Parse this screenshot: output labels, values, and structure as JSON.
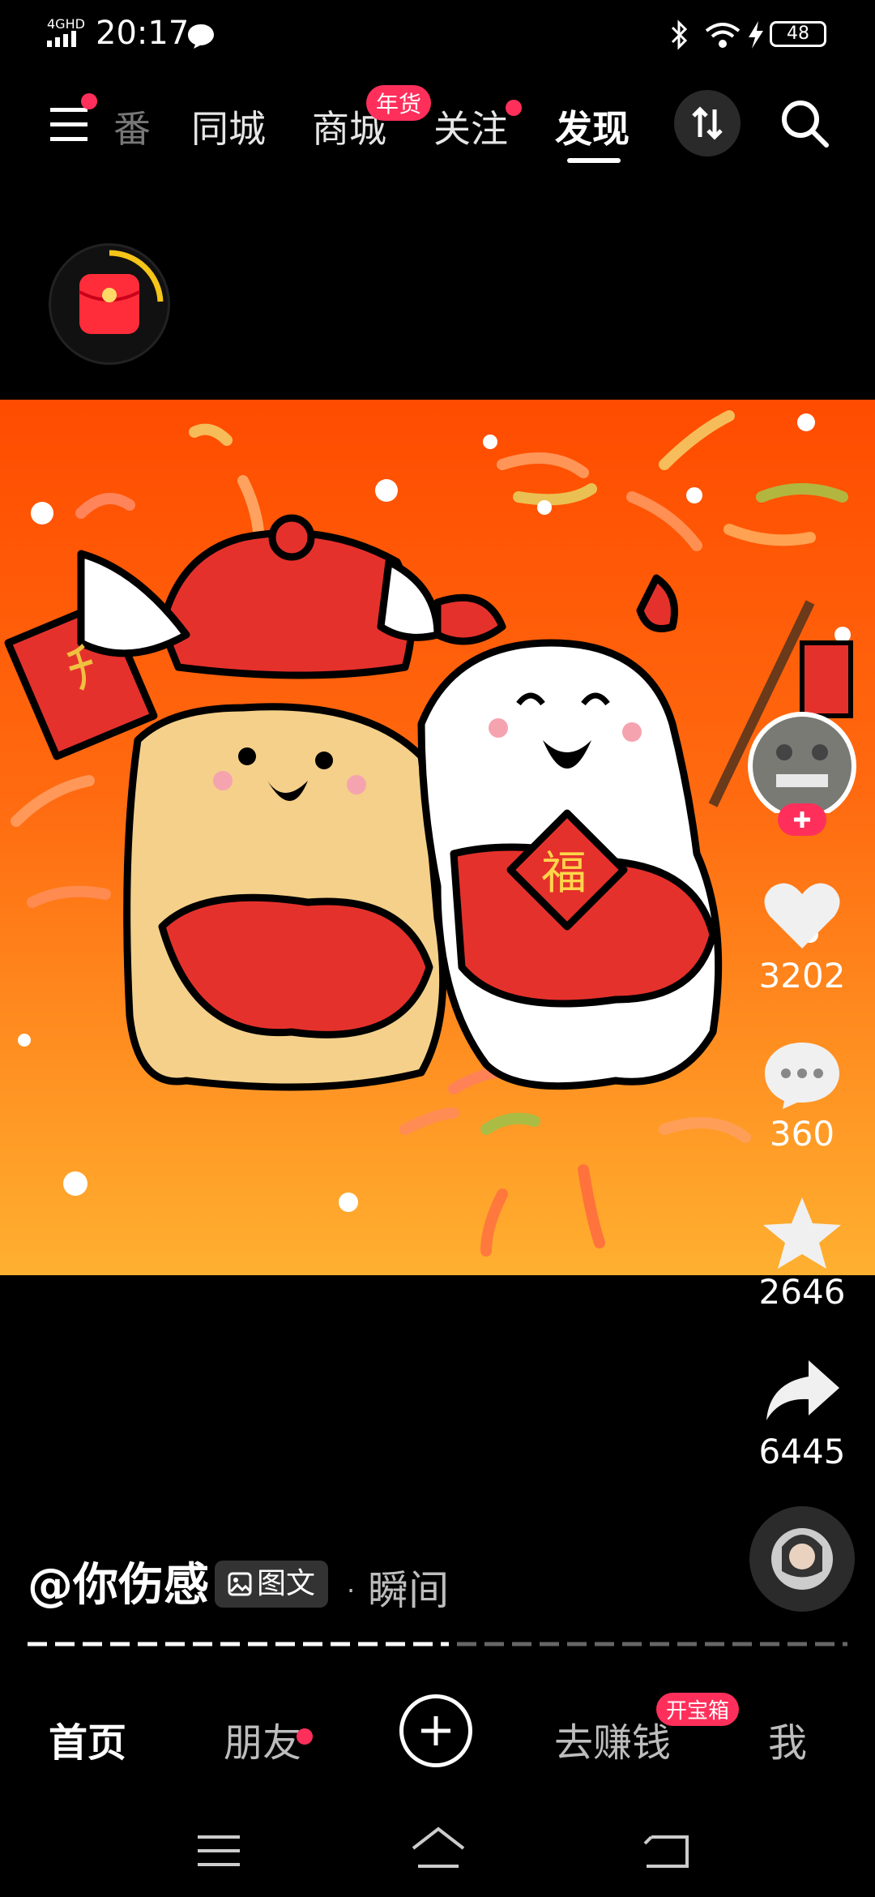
{
  "status_bar": {
    "network": "4GHD",
    "time": "20:17",
    "battery": "48"
  },
  "top_nav": {
    "tabs": [
      {
        "label": "番"
      },
      {
        "label": "同城"
      },
      {
        "label": "商城",
        "badge": "年货"
      },
      {
        "label": "关注"
      },
      {
        "label": "发现",
        "active": true
      }
    ]
  },
  "actions": {
    "likes": "3202",
    "comments": "360",
    "favorites": "2646",
    "shares": "6445"
  },
  "post": {
    "author": "@你伤感",
    "type_tag": "图文",
    "separator": "·",
    "time": "瞬间",
    "image_text": "福"
  },
  "bottom_nav": {
    "items": [
      {
        "label": "首页",
        "active": true
      },
      {
        "label": "朋友"
      },
      {
        "label": "去赚钱",
        "badge": "开宝箱"
      },
      {
        "label": "我"
      }
    ]
  },
  "colors": {
    "accent": "#ff2f5b",
    "bg": "#000000",
    "image_top": "#ff4c00",
    "image_bottom": "#ffb030"
  },
  "icons": [
    "menu-icon",
    "swap-icon",
    "search-icon",
    "red-packet-icon",
    "heart-icon",
    "comment-icon",
    "star-icon",
    "share-icon",
    "plus-icon",
    "image-icon",
    "sys-menu-icon",
    "sys-home-icon",
    "sys-back-icon"
  ]
}
